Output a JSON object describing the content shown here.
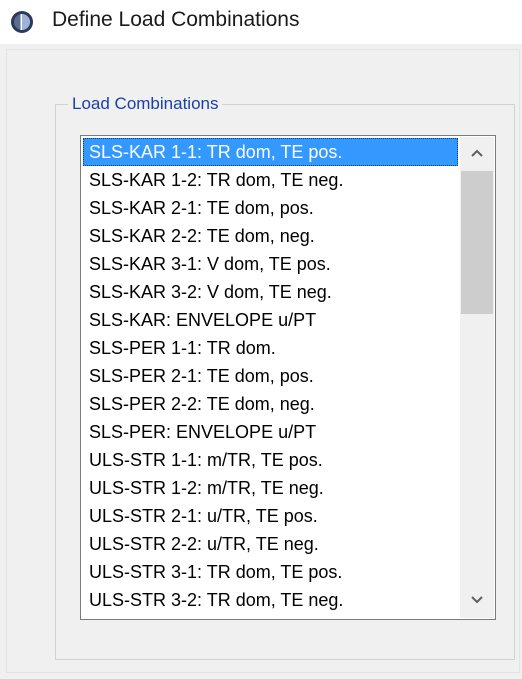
{
  "window": {
    "title": "Define Load Combinations",
    "icon": "app-icon"
  },
  "group": {
    "label": "Load Combinations"
  },
  "list": {
    "items": [
      "SLS-KAR 1-1: TR dom, TE pos.",
      "SLS-KAR 1-2: TR dom, TE neg.",
      "SLS-KAR 2-1: TE dom, pos.",
      "SLS-KAR 2-2: TE dom, neg.",
      "SLS-KAR 3-1: V dom, TE pos.",
      "SLS-KAR 3-2: V dom, TE neg.",
      "SLS-KAR: ENVELOPE u/PT",
      "SLS-PER 1-1: TR dom.",
      "SLS-PER 2-1: TE dom, pos.",
      "SLS-PER 2-2: TE dom, neg.",
      "SLS-PER: ENVELOPE u/PT",
      "ULS-STR 1-1: m/TR, TE pos.",
      "ULS-STR 1-2: m/TR, TE neg.",
      "ULS-STR 2-1: u/TR, TE pos.",
      "ULS-STR 2-2: u/TR, TE neg.",
      "ULS-STR 3-1: TR dom, TE pos.",
      "ULS-STR 3-2: TR dom, TE neg."
    ],
    "selected_index": 0,
    "scroll_position": 0
  },
  "colors": {
    "selection": "#3399ff",
    "group_label": "#1b3fa8"
  }
}
